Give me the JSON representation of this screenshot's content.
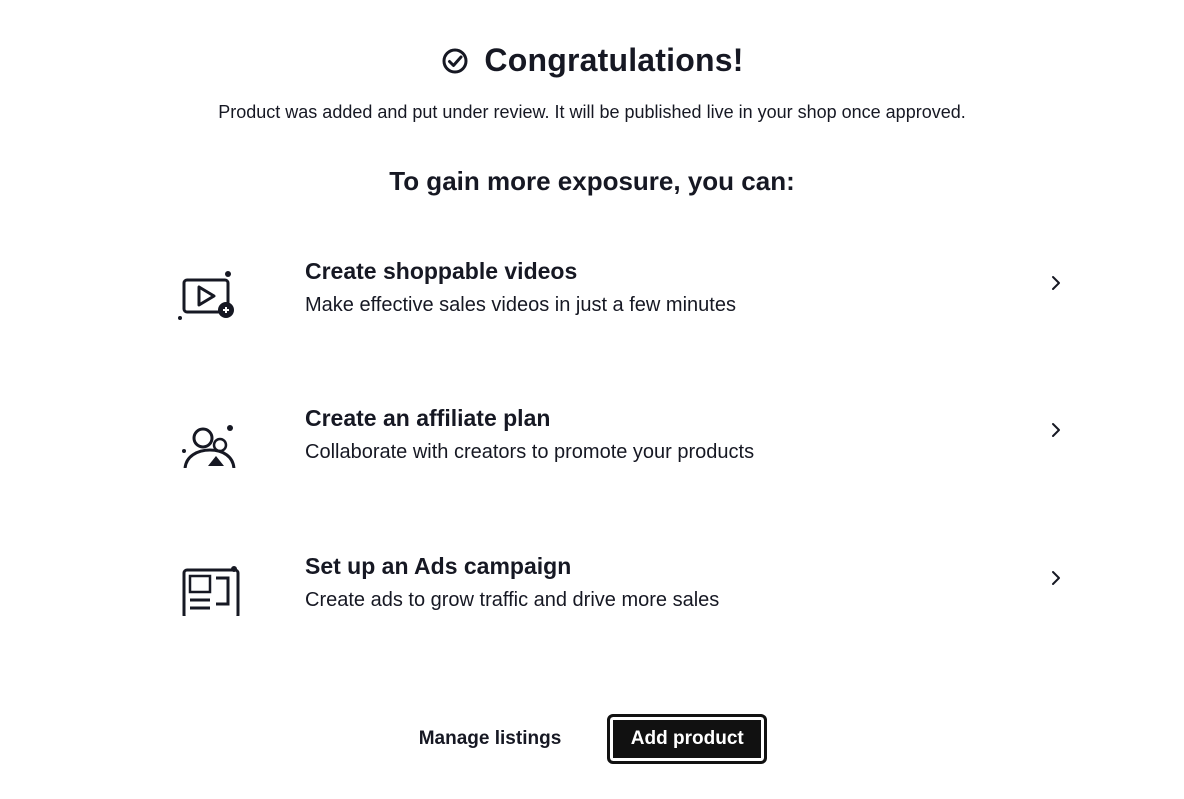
{
  "header": {
    "title": "Congratulations!",
    "subtitle": "Product was added and put under review. It will be published live in your shop once approved."
  },
  "exposure": {
    "heading": "To gain more exposure, you can:",
    "options": [
      {
        "title": "Create shoppable videos",
        "description": "Make effective sales videos in just a few minutes",
        "icon": "video-icon"
      },
      {
        "title": "Create an affiliate plan",
        "description": "Collaborate with creators to promote your products",
        "icon": "affiliate-icon"
      },
      {
        "title": "Set up an Ads campaign",
        "description": "Create ads to grow traffic and drive more sales",
        "icon": "ads-icon"
      }
    ]
  },
  "footer": {
    "manage_label": "Manage listings",
    "add_label": "Add product"
  }
}
